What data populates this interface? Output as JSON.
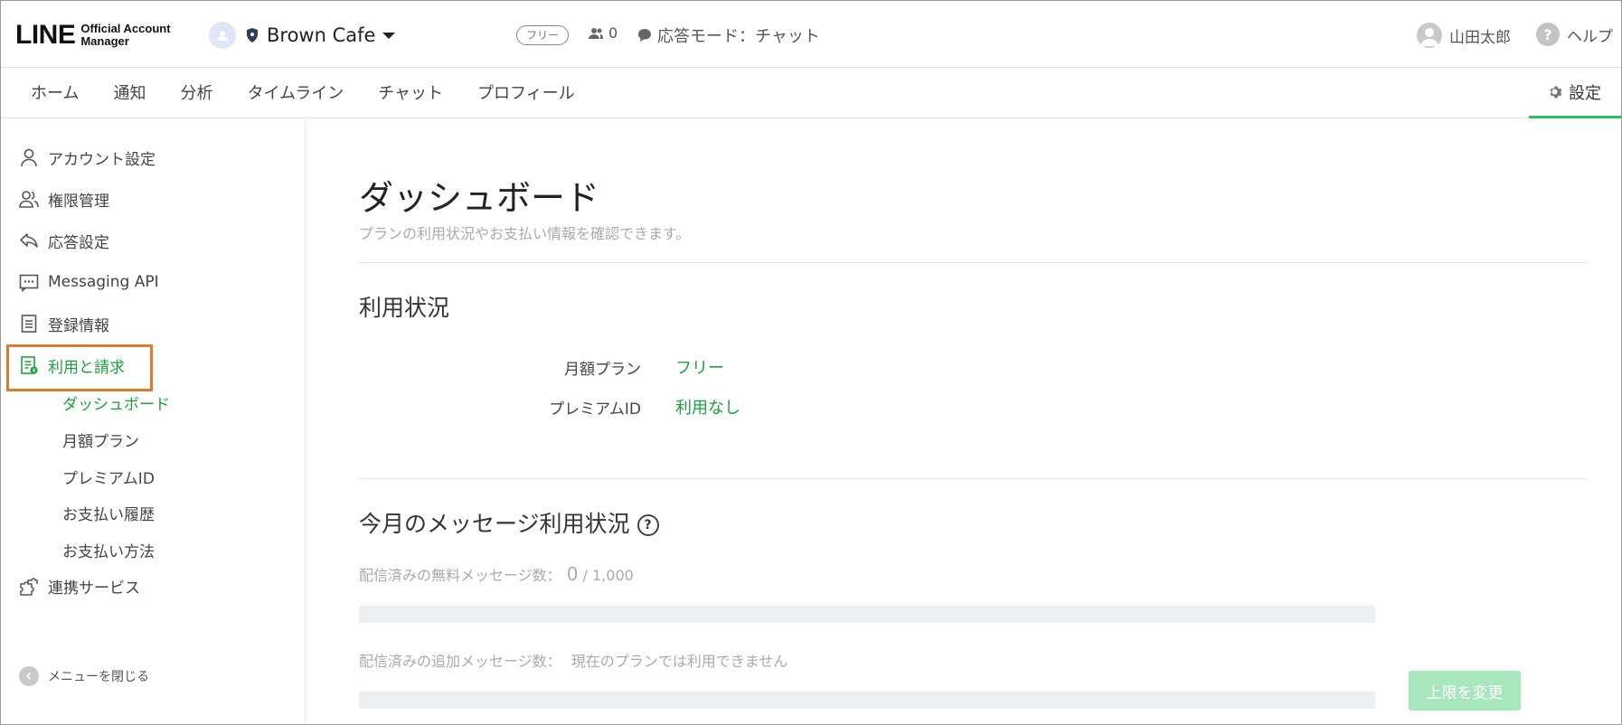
{
  "header": {
    "logo_main": "LINE",
    "logo_sub_1": "Official Account",
    "logo_sub_2": "Manager",
    "account_name": "Brown Cafe",
    "plan_badge": "フリー",
    "friend_count": "0",
    "response_mode": "応答モード：チャット",
    "user_name": "山田太郎",
    "help_label": "ヘルプ"
  },
  "nav": {
    "tabs": [
      "ホーム",
      "通知",
      "分析",
      "タイムライン",
      "チャット",
      "プロフィール"
    ],
    "settings_label": "設定"
  },
  "sidebar": {
    "items": [
      {
        "label": "アカウント設定",
        "icon": "user-icon"
      },
      {
        "label": "権限管理",
        "icon": "users-icon"
      },
      {
        "label": "応答設定",
        "icon": "reply-icon"
      },
      {
        "label": "Messaging API",
        "icon": "chat-dots-icon"
      },
      {
        "label": "登録情報",
        "icon": "document-icon"
      },
      {
        "label": "利用と請求",
        "icon": "billing-icon"
      }
    ],
    "sub_items": [
      "ダッシュボード",
      "月額プラン",
      "プレミアムID",
      "お支払い履歴",
      "お支払い方法"
    ],
    "integration_label": "連携サービス",
    "close_menu_label": "メニューを閉じる"
  },
  "main": {
    "title": "ダッシュボード",
    "description": "プランの利用状況やお支払い情報を確認できます。",
    "usage_title": "利用状況",
    "monthly_plan_label": "月額プラン",
    "monthly_plan_value": "フリー",
    "premium_id_label": "プレミアムID",
    "premium_id_value": "利用なし",
    "message_usage_title": "今月のメッセージ利用状況",
    "free_messages_label": "配信済みの無料メッセージ数：",
    "free_messages_count": "0",
    "free_messages_total": "/ 1,000",
    "free_messages_progress": 0,
    "additional_messages_label": "配信済みの追加メッセージ数：",
    "additional_messages_status": "現在のプランでは利用できません",
    "change_limit_button": "上限を変更"
  },
  "colors": {
    "accent_green": "#1aa33b",
    "tab_underline": "#21c55d",
    "highlight_orange": "#e07b2c",
    "disabled_button": "#a8e6bd"
  }
}
